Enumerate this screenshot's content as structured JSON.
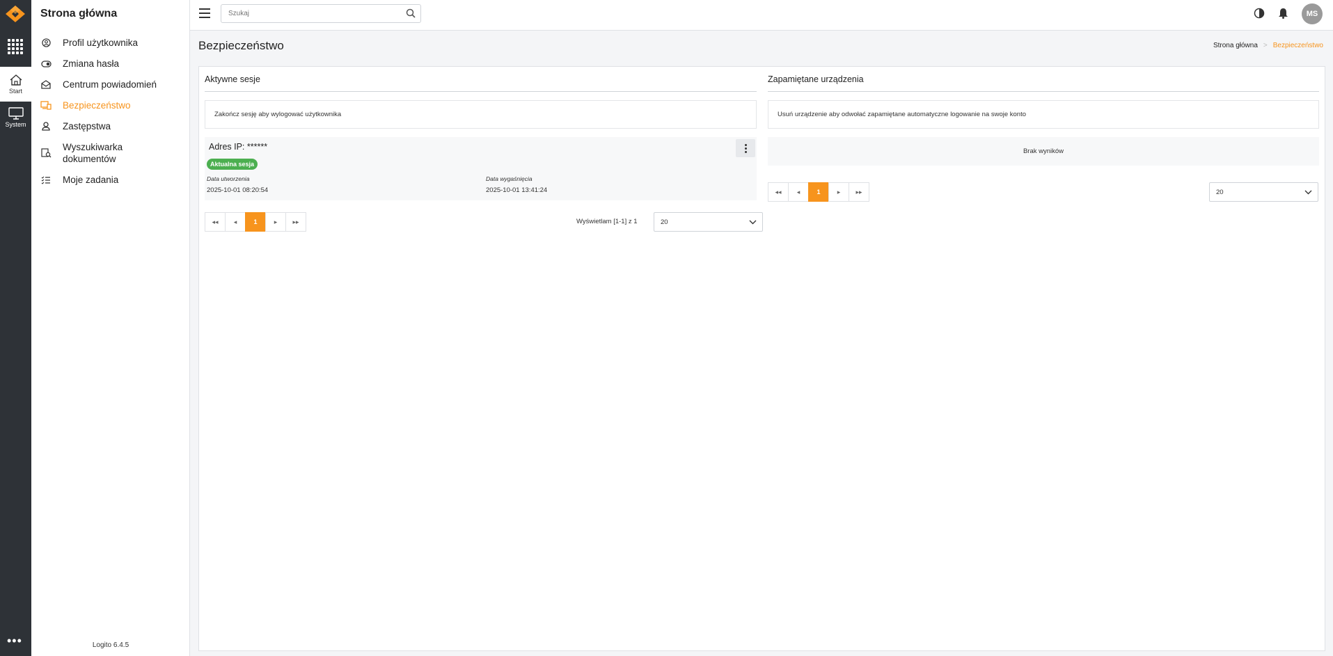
{
  "app": {
    "title": "Strona główna",
    "version": "Logito 6.4.5",
    "brand_color": "#f7941d"
  },
  "rail": {
    "items": [
      {
        "label": "Start",
        "icon": "home-icon"
      },
      {
        "label": "System",
        "icon": "monitor-icon"
      }
    ]
  },
  "sidebar": {
    "items": [
      {
        "label": "Profil użytkownika",
        "icon": "user-circle-icon"
      },
      {
        "label": "Zmiana hasła",
        "icon": "toggle-icon"
      },
      {
        "label": "Centrum powiadomień",
        "icon": "envelope-open-icon"
      },
      {
        "label": "Bezpieczeństwo",
        "icon": "devices-icon",
        "active": true
      },
      {
        "label": "Zastępstwa",
        "icon": "user-icon"
      },
      {
        "label": "Wyszukiwarka dokumentów",
        "icon": "document-search-icon"
      },
      {
        "label": "Moje zadania",
        "icon": "task-list-icon"
      }
    ]
  },
  "topbar": {
    "search_placeholder": "Szukaj",
    "avatar_initials": "MS"
  },
  "page": {
    "title": "Bezpieczeństwo",
    "breadcrumb": [
      "Strona główna",
      "Bezpieczeństwo"
    ]
  },
  "sessions": {
    "title": "Aktywne sesje",
    "info": "Zakończ sesję aby wylogować użytkownika",
    "item": {
      "ip": "Adres IP: ******",
      "badge": "Aktualna sesja",
      "created_label": "Data utworzenia",
      "created": "2025-10-01 08:20:54",
      "expires_label": "Data wygaśnięcia",
      "expires": "2025-10-01 13:41:24"
    },
    "current_page": "1",
    "showing": "Wyświetlam [1-1] z 1",
    "page_size": "20"
  },
  "devices": {
    "title": "Zapamiętane urządzenia",
    "info": "Usuń urządzenie aby odwołać zapamiętane automatyczne logowanie na swoje konto",
    "empty": "Brak wyników",
    "current_page": "1",
    "page_size": "20"
  }
}
